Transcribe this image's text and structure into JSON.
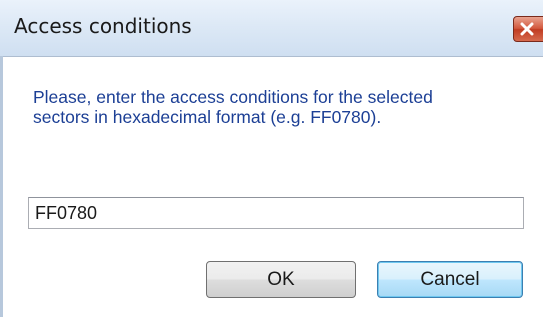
{
  "window": {
    "title": "Access conditions",
    "close_icon": "close-x-icon"
  },
  "message": {
    "text": "Please, enter the access conditions for the selected sectors in hexadecimal format (e.g. FF0780)."
  },
  "input": {
    "value": "FF0780"
  },
  "buttons": {
    "ok_label": "OK",
    "cancel_label": "Cancel"
  },
  "colors": {
    "message_text": "#1c3f95",
    "close_button": "#c03c22",
    "focused_button_border": "#3c7fb1"
  }
}
